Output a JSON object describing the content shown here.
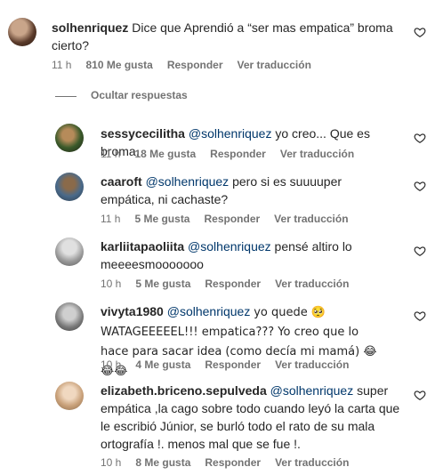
{
  "main_comment": {
    "username": "solhenriquez",
    "text": "Dice que Aprendió a “ser mas empatica” broma cierto?",
    "time": "11 h",
    "likes": "810 Me gusta",
    "reply_label": "Responder",
    "translate_label": "Ver traducción"
  },
  "hide_replies_label": "Ocultar respuestas",
  "replies": [
    {
      "username": "sessycecilitha",
      "mention": "@solhenriquez",
      "text": "yo creo... Que es broma.",
      "time": "11 h",
      "likes": "18 Me gusta",
      "reply_label": "Responder",
      "translate_label": "Ver traducción"
    },
    {
      "username": "caaroft",
      "mention": "@solhenriquez",
      "text": "pero si es suuuuper empática, ni cachaste?",
      "time": "11 h",
      "likes": "5 Me gusta",
      "reply_label": "Responder",
      "translate_label": "Ver traducción"
    },
    {
      "username": "karliitapaoliita",
      "mention": "@solhenriquez",
      "text": "pensé altiro lo meeeesmooooooo",
      "time": "10 h",
      "likes": "5 Me gusta",
      "reply_label": "Responder",
      "translate_label": "Ver traducción"
    },
    {
      "username": "vivyta1980",
      "mention": "@solhenriquez",
      "text": "yo quede 🥺 WATAGEEEEEL!!! empatica??? Yo creo que lo hace para sacar idea (como decía mi mamá) 😂😂😂",
      "time": "10 h",
      "likes": "4 Me gusta",
      "reply_label": "Responder",
      "translate_label": "Ver traducción"
    },
    {
      "username": "elizabeth.briceno.sepulveda",
      "mention": "@solhenriquez",
      "text": "super empática ,la cago sobre todo cuando leyó la carta que le escribió Júnior, se burló todo el rato de su mala ortografía !. menos mal que se fue !.",
      "time": "10 h",
      "likes": "8 Me gusta",
      "reply_label": "Responder",
      "translate_label": "Ver traducción"
    }
  ]
}
